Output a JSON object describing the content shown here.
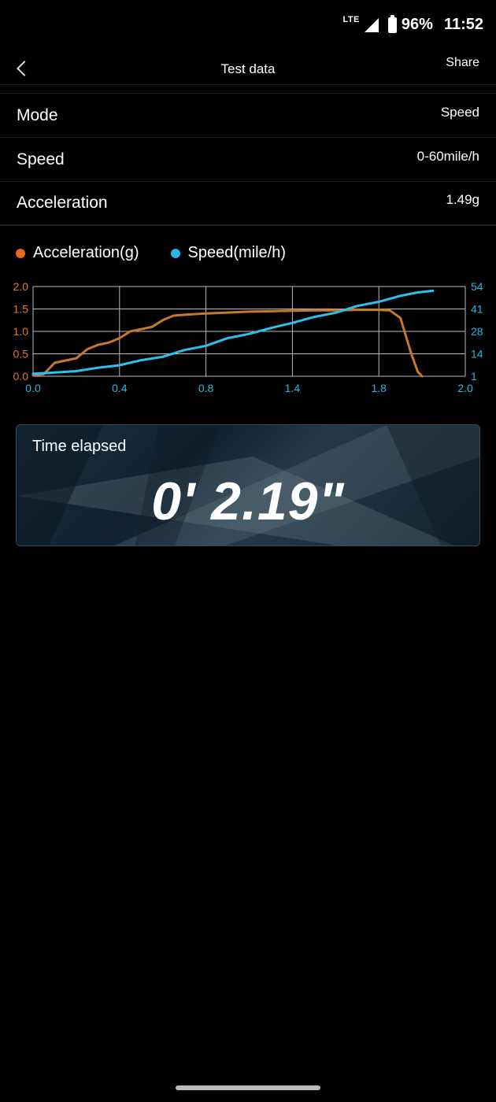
{
  "status": {
    "network": "LTE",
    "battery": "96%",
    "time": "11:52"
  },
  "header": {
    "title": "Test data",
    "share_label": "Share"
  },
  "info": [
    {
      "label": "Mode",
      "value": "Speed"
    },
    {
      "label": "Speed",
      "value": "0-60mile/h"
    },
    {
      "label": "Acceleration",
      "value": "1.49g"
    }
  ],
  "legend": [
    {
      "label": "Acceleration(g)",
      "color": "#e8681c"
    },
    {
      "label": "Speed(mile/h)",
      "color": "#29b6e6"
    }
  ],
  "chart_data": {
    "type": "line",
    "x_ticks": [
      "0.0",
      "0.4",
      "0.8",
      "1.4",
      "1.8",
      "2.0"
    ],
    "left_ticks": [
      "2.0",
      "1.5",
      "1.0",
      "0.5",
      "0.0"
    ],
    "right_ticks": [
      "54",
      "41",
      "28",
      "14",
      "1"
    ],
    "xlim": [
      0,
      2.0
    ],
    "ylim_left": [
      0,
      2.0
    ],
    "ylim_right": [
      1,
      54
    ],
    "grid": true,
    "series": [
      {
        "name": "Acceleration(g)",
        "axis": "left",
        "color": "#c47a2a",
        "x": [
          0.0,
          0.05,
          0.1,
          0.15,
          0.2,
          0.25,
          0.3,
          0.35,
          0.4,
          0.45,
          0.5,
          0.55,
          0.6,
          0.65,
          0.7,
          0.8,
          0.9,
          1.0,
          1.1,
          1.2,
          1.3,
          1.4,
          1.5,
          1.55,
          1.6,
          1.65,
          1.7,
          1.75,
          1.78,
          1.8
        ],
        "y": [
          0.02,
          0.05,
          0.3,
          0.35,
          0.4,
          0.6,
          0.7,
          0.75,
          0.85,
          1.0,
          1.05,
          1.1,
          1.25,
          1.35,
          1.37,
          1.4,
          1.42,
          1.44,
          1.45,
          1.46,
          1.47,
          1.47,
          1.48,
          1.48,
          1.48,
          1.47,
          1.3,
          0.5,
          0.1,
          0.0
        ]
      },
      {
        "name": "Speed(mile/h)",
        "axis": "right",
        "color": "#2cc0ee",
        "x": [
          0.0,
          0.1,
          0.2,
          0.3,
          0.4,
          0.5,
          0.6,
          0.7,
          0.8,
          0.9,
          1.0,
          1.1,
          1.2,
          1.3,
          1.4,
          1.5,
          1.6,
          1.7,
          1.78,
          1.85
        ],
        "y": [
          2.5,
          3.2,
          4.0,
          6.0,
          7.5,
          10.5,
          12.5,
          16.5,
          19.0,
          23.5,
          26.0,
          29.5,
          32.5,
          36.0,
          38.5,
          42.5,
          45.0,
          48.5,
          50.5,
          51.5
        ]
      }
    ]
  },
  "elapsed": {
    "label": "Time elapsed",
    "value": "0' 2.19\""
  }
}
